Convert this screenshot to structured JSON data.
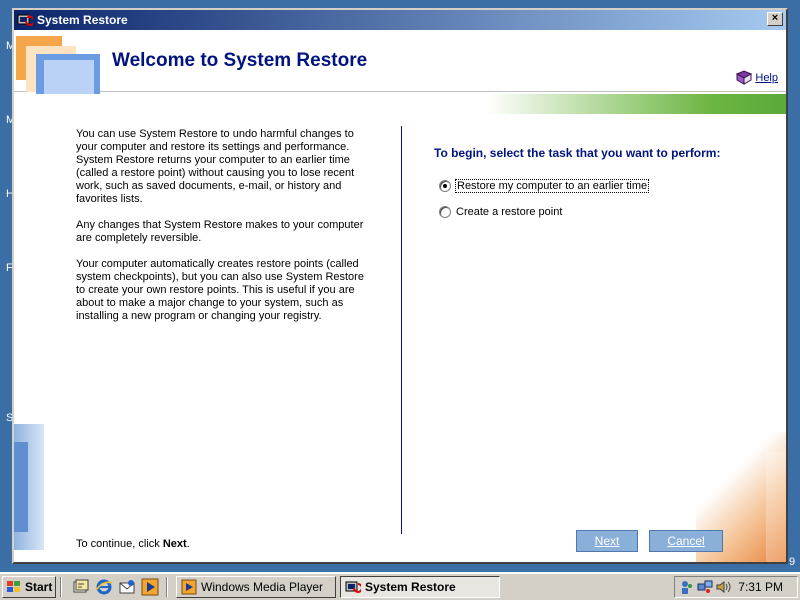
{
  "desktop": {
    "letters": [
      "M",
      "M",
      "H",
      "F",
      "S"
    ],
    "edge_text": "9"
  },
  "window": {
    "title": "System Restore",
    "close_label": "×"
  },
  "header": {
    "welcome": "Welcome to System Restore",
    "help_label": "Help"
  },
  "body": {
    "paragraphs": [
      "You can use System Restore to undo harmful changes to your computer and restore its settings and performance. System Restore returns your computer to an earlier time (called a restore point) without causing you to lose recent work, such as saved documents, e-mail, or history and favorites lists.",
      "Any changes that System Restore makes to your computer are completely reversible.",
      "Your computer automatically creates restore points (called system checkpoints), but you can also use System Restore to create your own restore points. This is useful if you are about to make a major change to your system, such as installing a new program or changing your registry."
    ],
    "continue_prefix": "To continue, click ",
    "continue_bold": "Next",
    "continue_suffix": "."
  },
  "task": {
    "prompt": "To begin, select the task that you want to perform:",
    "options": [
      {
        "label": "Restore my computer to an earlier time",
        "selected": true
      },
      {
        "label": "Create a restore point",
        "selected": false
      }
    ]
  },
  "buttons": {
    "next": "Next",
    "cancel": "Cancel"
  },
  "taskbar": {
    "start_label": "Start",
    "tasks": [
      "Windows Media Player",
      "System Restore"
    ],
    "clock": "7:31 PM"
  },
  "colors": {
    "title_blue": "#00137f",
    "accent_green": "#6cb542",
    "accent_orange": "#e8823a",
    "button_blue": "#8ab0d9"
  }
}
